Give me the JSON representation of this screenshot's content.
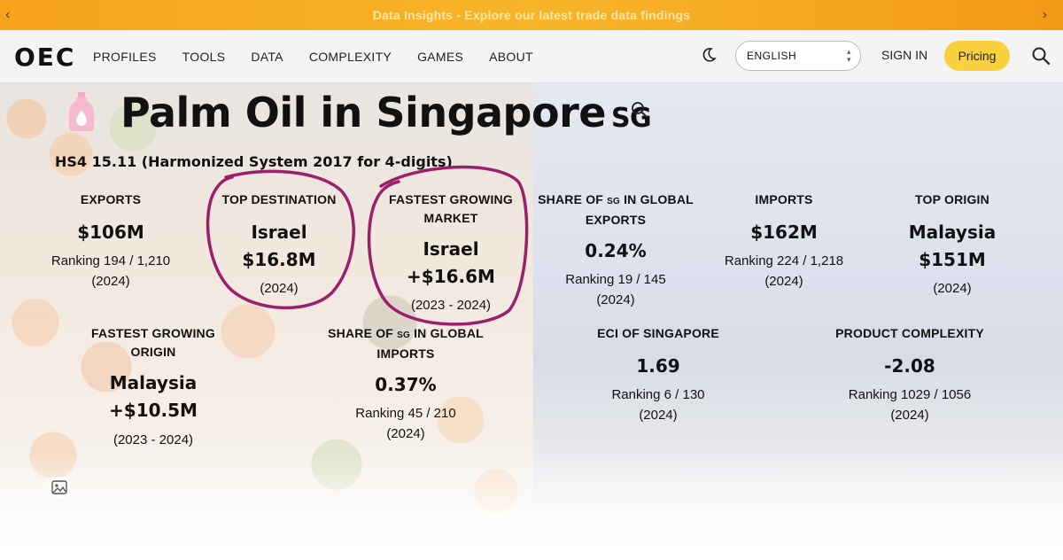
{
  "banner": {
    "text": "Data Insights - Explore our latest trade data findings"
  },
  "nav": {
    "logo": "OEC",
    "menu": [
      "PROFILES",
      "TOOLS",
      "DATA",
      "COMPLEXITY",
      "GAMES",
      "ABOUT"
    ],
    "language": "ENGLISH",
    "sign_in": "SIGN IN",
    "pricing": "Pricing"
  },
  "page": {
    "title": "Palm Oil in Singapore",
    "country_code": "SG",
    "hs_code": "HS4 15.11 (Harmonized System 2017 for 4-digits)"
  },
  "stats_row1": [
    {
      "label": "EXPORTS",
      "value": "$106M",
      "sub1": "Ranking 194 / 1,210",
      "sub2": "(2024)"
    },
    {
      "label": "TOP DESTINATION",
      "value": "Israel",
      "value2": "$16.8M",
      "sub1": "(2024)"
    },
    {
      "label": "FASTEST GROWING",
      "label2": "MARKET",
      "value": "Israel",
      "value2": "+$16.6M",
      "sub1": "(2023 - 2024)"
    },
    {
      "label_pre": "SHARE OF ",
      "label_sg": "SG",
      "label_post": " IN GLOBAL",
      "label2": "EXPORTS",
      "value": "0.24%",
      "sub1": "Ranking 19 / 145",
      "sub2": "(2024)"
    },
    {
      "label": "IMPORTS",
      "value": "$162M",
      "sub1": "Ranking 224 / 1,218",
      "sub2": "(2024)"
    },
    {
      "label": "TOP ORIGIN",
      "value": "Malaysia",
      "value2": "$151M",
      "sub1": "(2024)"
    }
  ],
  "stats_row2": [
    {
      "label": "FASTEST GROWING",
      "label2": "ORIGIN",
      "value": "Malaysia",
      "value2": "+$10.5M",
      "sub1": "(2023 - 2024)"
    },
    {
      "label_pre": "SHARE OF ",
      "label_sg": "SG",
      "label_post": " IN GLOBAL",
      "label2": "IMPORTS",
      "value": "0.37%",
      "sub1": "Ranking 45 / 210",
      "sub2": "(2024)"
    },
    {
      "label": "ECI OF SINGAPORE",
      "value": "1.69",
      "sub1": "Ranking 6 / 130",
      "sub2": "(2024)"
    },
    {
      "label": "PRODUCT COMPLEXITY",
      "value": "-2.08",
      "sub1": "Ranking 1029 / 1056",
      "sub2": "(2024)"
    }
  ],
  "colors": {
    "banner": "#f6a31c",
    "pricing": "#f9d13e",
    "annotation": "#9b1f6a"
  }
}
